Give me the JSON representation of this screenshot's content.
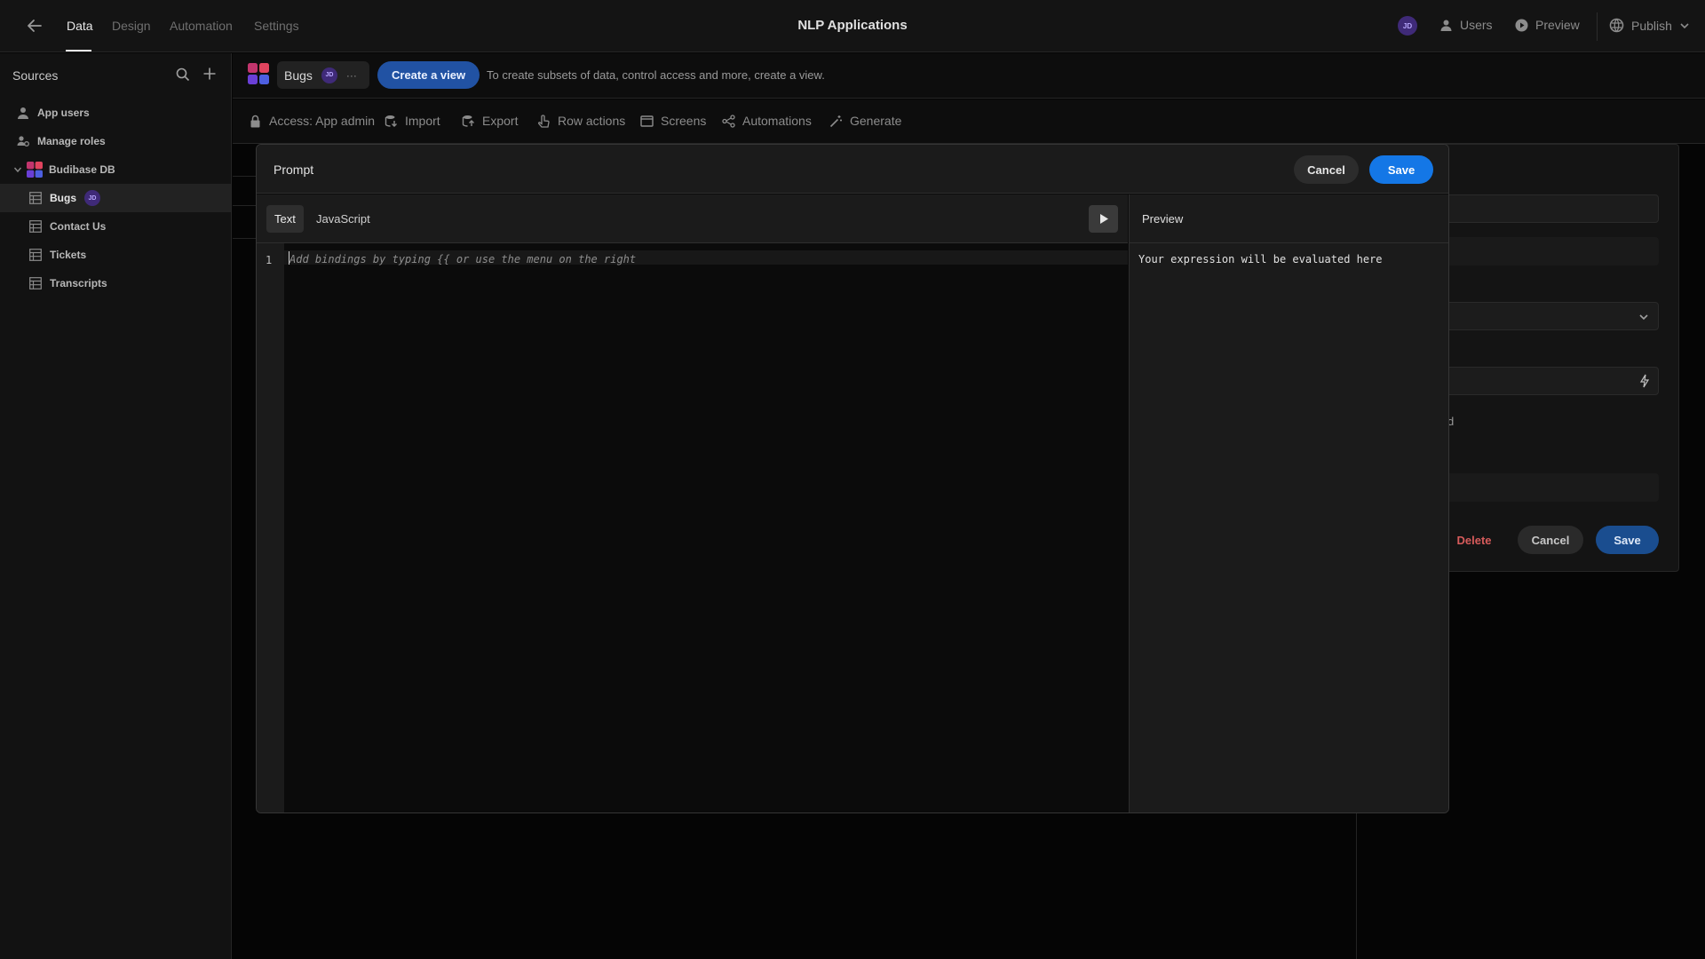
{
  "app": {
    "title": "NLP Applications"
  },
  "nav": {
    "tabs": [
      "Data",
      "Design",
      "Automation",
      "Settings"
    ],
    "active": "Data"
  },
  "top_actions": {
    "avatar": "JD",
    "users": "Users",
    "preview": "Preview",
    "publish": "Publish"
  },
  "sidebar": {
    "title": "Sources",
    "items": [
      {
        "label": "App users",
        "icon": "user-icon"
      },
      {
        "label": "Manage roles",
        "icon": "roles-icon"
      },
      {
        "label": "Budibase DB",
        "icon": "budibase-logo"
      },
      {
        "label": "Bugs",
        "icon": "table-icon",
        "badge": "JD"
      },
      {
        "label": "Contact Us",
        "icon": "table-icon"
      },
      {
        "label": "Tickets",
        "icon": "table-icon"
      },
      {
        "label": "Transcripts",
        "icon": "table-icon"
      }
    ]
  },
  "header": {
    "table_name": "Bugs",
    "table_badge": "JD",
    "more": "···",
    "create_view": "Create a view",
    "create_view_hint": "To create subsets of data, control access and more, create a view."
  },
  "toolbar": {
    "access": "Access: App admin",
    "import": "Import",
    "export": "Export",
    "row_actions": "Row actions",
    "screens": "Screens",
    "automations": "Automations",
    "generate": "Generate"
  },
  "right_panel": {
    "partial_label": "d",
    "delete": "Delete",
    "cancel": "Cancel",
    "save": "Save"
  },
  "modal": {
    "title": "Prompt",
    "cancel": "Cancel",
    "save": "Save",
    "tabs": [
      "Text",
      "JavaScript"
    ],
    "active_tab": "Text",
    "line_number": "1",
    "placeholder": "Add bindings by typing {{ or use the menu on the right",
    "preview_title": "Preview",
    "preview_text": "Your expression will be evaluated here"
  },
  "colors": {
    "accent": "#1477e6",
    "create_view": "#2152a3",
    "delete": "#d65b5b",
    "avatar": "#3f2a78"
  }
}
